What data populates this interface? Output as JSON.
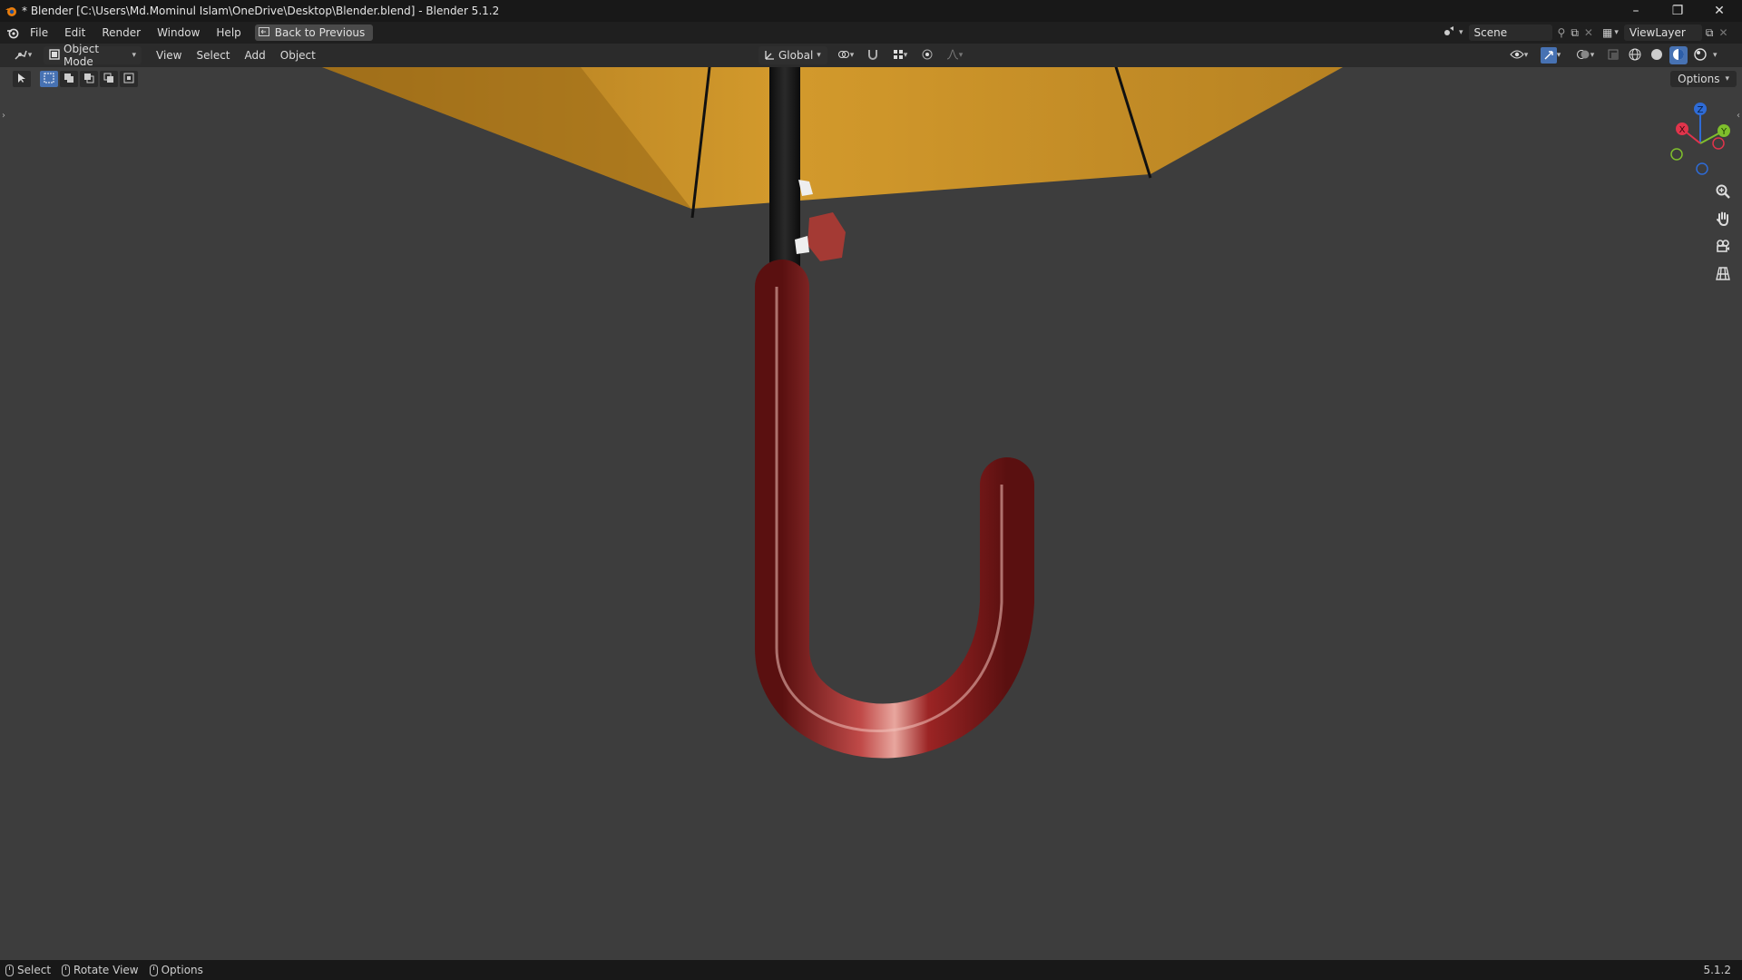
{
  "window": {
    "title": "* Blender [C:\\Users\\Md.Mominul Islam\\OneDrive\\Desktop\\Blender.blend] - Blender 5.1.2",
    "minimize": "–",
    "maximize": "❐",
    "close": "✕"
  },
  "menubar": {
    "items": [
      "File",
      "Edit",
      "Render",
      "Window",
      "Help"
    ],
    "back_button": "Back to Previous",
    "scene_label": "Scene",
    "viewlayer_label": "ViewLayer"
  },
  "viewport_header": {
    "mode": "Object Mode",
    "menus": [
      "View",
      "Select",
      "Add",
      "Object"
    ],
    "transform_orientation": "Global",
    "options_label": "Options"
  },
  "gizmo": {
    "axis_x": "X",
    "axis_y": "Y",
    "axis_z": "Z"
  },
  "statusbar": {
    "select": "Select",
    "rotate": "Rotate View",
    "options": "Options",
    "version": "5.1.2"
  },
  "colors": {
    "canopy": "#c8902a",
    "handle": "#8e1d1d",
    "shaft": "#151515",
    "viewport_bg": "#3d3d3d",
    "accent": "#4772b3"
  }
}
